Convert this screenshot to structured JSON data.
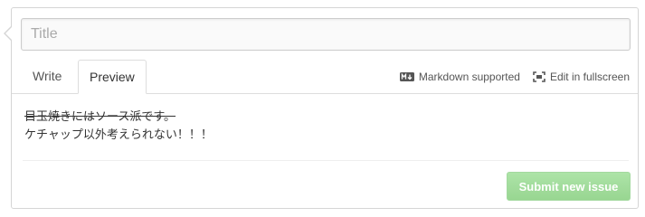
{
  "issue_form": {
    "title_placeholder": "Title",
    "title_value": ""
  },
  "tabs": {
    "write_label": "Write",
    "preview_label": "Preview",
    "active": "Preview"
  },
  "toolbar": {
    "markdown_label": "Markdown supported",
    "markdown_icon": "markdown-icon",
    "fullscreen_label": "Edit in fullscreen",
    "fullscreen_icon": "fullscreen-icon"
  },
  "preview": {
    "line1": "目玉焼きにはソース派です。",
    "line2": "ケチャップ以外考えられない！！！"
  },
  "submit": {
    "label": "Submit new issue",
    "color": "#94d68d",
    "disabled": true
  }
}
